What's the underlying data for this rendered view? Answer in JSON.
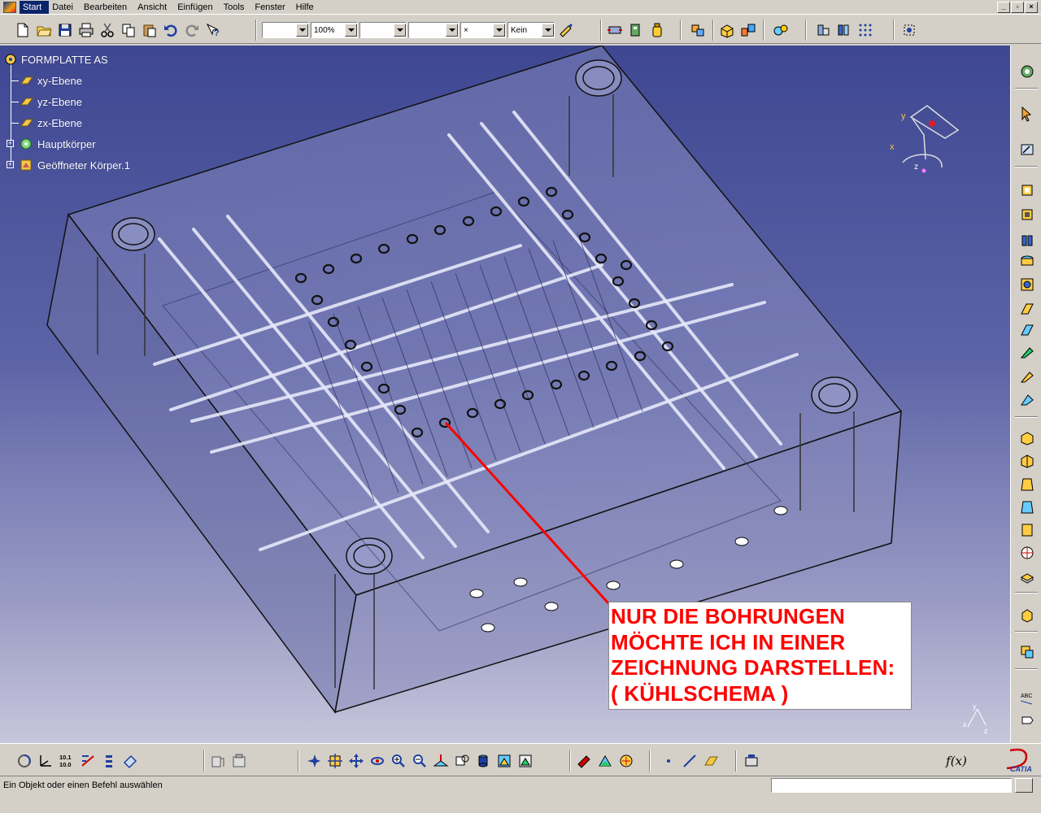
{
  "menu": {
    "items": [
      "Start",
      "Datei",
      "Bearbeiten",
      "Ansicht",
      "Einfügen",
      "Tools",
      "Fenster",
      "Hilfe"
    ],
    "active": "Start"
  },
  "window_controls": [
    "_",
    "▫",
    "×"
  ],
  "toolbar_top": {
    "color_combo": "",
    "zoom_combo": "100%",
    "linetype_combo": "",
    "lineweight_combo": "",
    "point_combo": "×",
    "layer_combo": "Kein"
  },
  "spec_tree": {
    "root": "FORMPLATTE AS",
    "items": [
      "xy-Ebene",
      "yz-Ebene",
      "zx-Ebene",
      "Hauptkörper",
      "Geöffneter Körper.1"
    ]
  },
  "compass": {
    "x": "x",
    "y": "y",
    "z": "z"
  },
  "annotation": {
    "lines": [
      "NUR DIE BOHRUNGEN",
      "MÖCHTE ICH IN EINER",
      "ZEICHNUNG DARSTELLEN:",
      "( KÜHLSCHEMA )"
    ],
    "color": "#ff0000"
  },
  "toolbar_bottom": {
    "fx_label": "f(x)",
    "grid_label_top": "10.1",
    "grid_label_bottom": "10.0"
  },
  "status": {
    "text": "Ein Objekt oder einen Befehl auswählen",
    "command_value": ""
  },
  "catia_logo": "CATIA"
}
